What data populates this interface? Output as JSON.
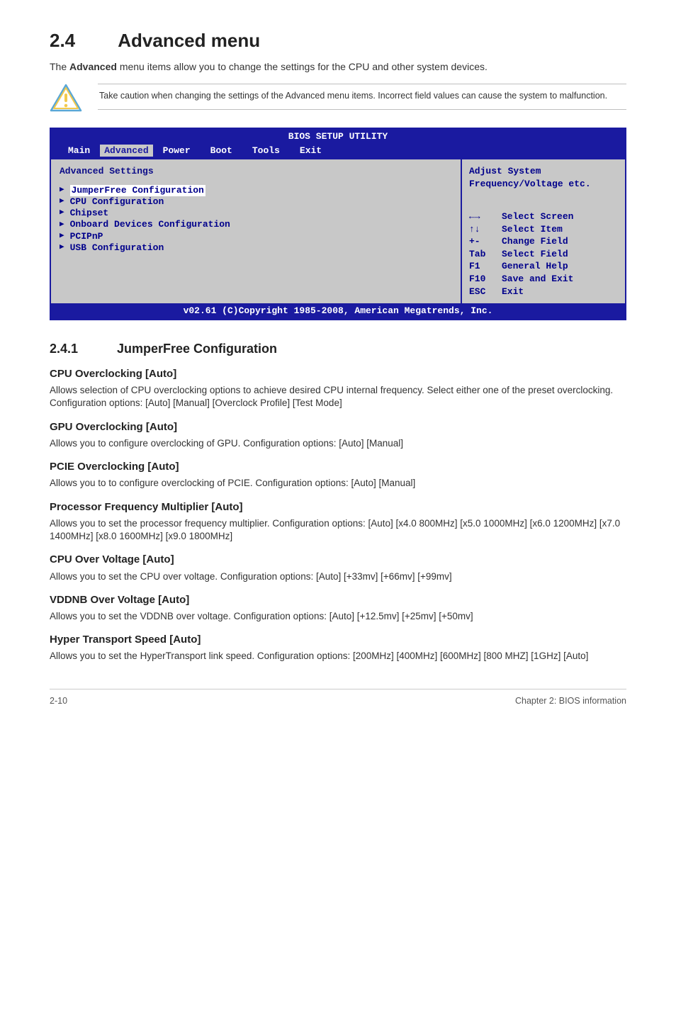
{
  "section": {
    "number": "2.4",
    "title": "Advanced menu"
  },
  "intro_pre": "The ",
  "intro_bold": "Advanced",
  "intro_post": " menu items allow you to change the settings for the CPU and other system devices.",
  "caution": "Take caution when changing the settings of the Advanced menu items. Incorrect field values can cause the system to malfunction.",
  "bios": {
    "header": "BIOS SETUP UTILITY",
    "menubar": [
      "Main",
      "Advanced",
      "Power",
      "Boot",
      "Tools",
      "Exit"
    ],
    "active_tab": "Advanced",
    "left_heading": "Advanced Settings",
    "items": [
      "JumperFree Configuration",
      "CPU Configuration",
      "Chipset",
      "Onboard Devices Configuration",
      "PCIPnP",
      "USB Configuration"
    ],
    "help_line1": "Adjust System",
    "help_line2": "Frequency/Voltage etc.",
    "keys": [
      {
        "k": "←→",
        "d": "Select Screen"
      },
      {
        "k": "↑↓",
        "d": "Select Item"
      },
      {
        "k": "+-",
        "d": "Change Field"
      },
      {
        "k": "Tab",
        "d": "Select Field"
      },
      {
        "k": "F1",
        "d": "General Help"
      },
      {
        "k": "F10",
        "d": "Save and Exit"
      },
      {
        "k": "ESC",
        "d": "Exit"
      }
    ],
    "footer": "v02.61 (C)Copyright 1985-2008, American Megatrends, Inc."
  },
  "subsection": {
    "number": "2.4.1",
    "title": "JumperFree Configuration"
  },
  "opts": [
    {
      "h": "CPU Overclocking [Auto]",
      "d": "Allows selection of CPU overclocking options to achieve desired CPU internal frequency. Select either one of the preset overclocking. Configuration options: [Auto] [Manual] [Overclock Profile] [Test Mode]"
    },
    {
      "h": "GPU Overclocking [Auto]",
      "d": "Allows you to configure overclocking of GPU. Configuration options: [Auto] [Manual]"
    },
    {
      "h": "PCIE Overclocking [Auto]",
      "d": "Allows you to to configure overclocking of PCIE. Configuration options: [Auto] [Manual]"
    },
    {
      "h": "Processor Frequency Multiplier [Auto]",
      "d": "Allows you to set the processor frequency multiplier. Configuration options: [Auto] [x4.0 800MHz] [x5.0 1000MHz] [x6.0 1200MHz] [x7.0 1400MHz] [x8.0 1600MHz] [x9.0 1800MHz]"
    },
    {
      "h": "CPU Over Voltage [Auto]",
      "d": "Allows you to set the CPU over voltage. Configuration options: [Auto] [+33mv] [+66mv] [+99mv]"
    },
    {
      "h": "VDDNB Over Voltage [Auto]",
      "d": "Allows you to set the VDDNB over voltage. Configuration options: [Auto] [+12.5mv] [+25mv] [+50mv]"
    },
    {
      "h": "Hyper Transport Speed [Auto]",
      "d": "Allows you to set the HyperTransport link speed. Configuration options: [200MHz] [400MHz] [600MHz] [800 MHZ] [1GHz] [Auto]"
    }
  ],
  "footer": {
    "left": "2-10",
    "right": "Chapter 2: BIOS information"
  }
}
